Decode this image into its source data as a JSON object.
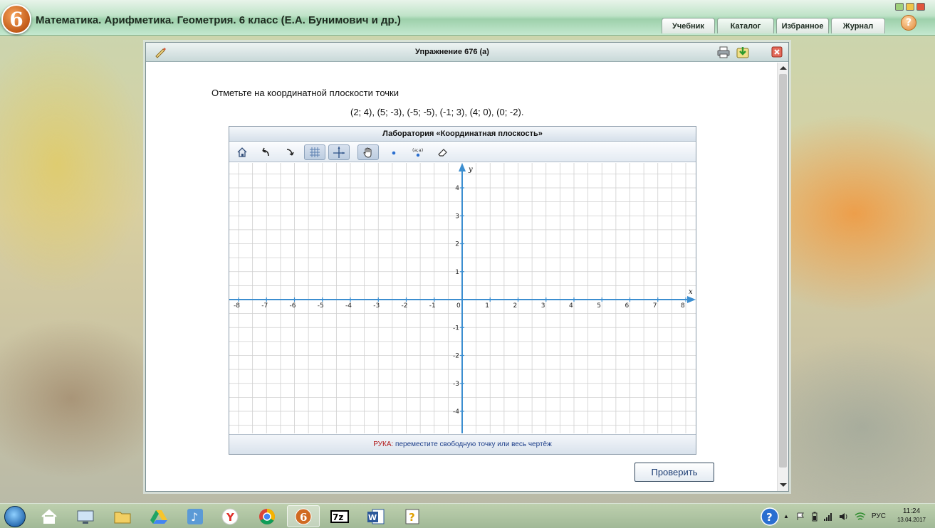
{
  "app": {
    "logo_digit": "6",
    "title": "Математика. Арифметика. Геометрия. 6 класс (Е.А. Бунимович и др.)",
    "tabs": [
      {
        "label": "Учебник",
        "active": false
      },
      {
        "label": "Каталог",
        "active": true
      },
      {
        "label": "Избранное",
        "active": false
      },
      {
        "label": "Журнал",
        "active": false
      }
    ],
    "help": "?"
  },
  "exercise": {
    "title": "Упражнение 676 (а)",
    "instruction_line1": "Отметьте на координатной плоскости точки",
    "instruction_line2": "(2; 4), (5; -3), (-5; -5), (-1; 3), (4; 0), (0; -2).",
    "check_button": "Проверить"
  },
  "lab": {
    "title": "Лаборатория «Координатная плоскость»",
    "tools": [
      {
        "name": "home-icon",
        "pressed": false
      },
      {
        "name": "undo-icon",
        "pressed": false
      },
      {
        "name": "redo-icon",
        "pressed": false
      },
      {
        "name": "grid-icon",
        "pressed": true
      },
      {
        "name": "axes-icon",
        "pressed": true
      },
      {
        "name": "hand-icon",
        "pressed": true
      },
      {
        "name": "point-icon",
        "pressed": false
      },
      {
        "name": "point-coordinates-icon",
        "pressed": false
      },
      {
        "name": "eraser-icon",
        "pressed": false
      }
    ],
    "status_key": "РУКА:",
    "status_text": "переместите свободную точку или весь чертёж"
  },
  "plane": {
    "x_label": "x",
    "y_label": "y",
    "x_range": [
      -8,
      8
    ],
    "y_range": [
      -4,
      4
    ],
    "x_ticks": [
      "-8",
      "-7",
      "-6",
      "-5",
      "-4",
      "-3",
      "-2",
      "-1",
      "0",
      "1",
      "2",
      "3",
      "4",
      "5",
      "6",
      "7",
      "8"
    ],
    "y_ticks": [
      "4",
      "3",
      "2",
      "1",
      "-1",
      "-2",
      "-3",
      "-4"
    ],
    "grid": true,
    "axis_color": "#3c8ed0",
    "grid_color": "#cfcfcf"
  },
  "taskbar": {
    "apps": [
      "explorer-icon",
      "monitor-icon",
      "folder-icon",
      "google-drive-icon",
      "music-icon",
      "yandex-browser-icon",
      "chrome-icon",
      "textbook-app-icon",
      "7zip-icon",
      "word-icon",
      "help-file-icon"
    ],
    "tray_language": "РУС",
    "time": "11:24",
    "date": "13.04.2017"
  }
}
